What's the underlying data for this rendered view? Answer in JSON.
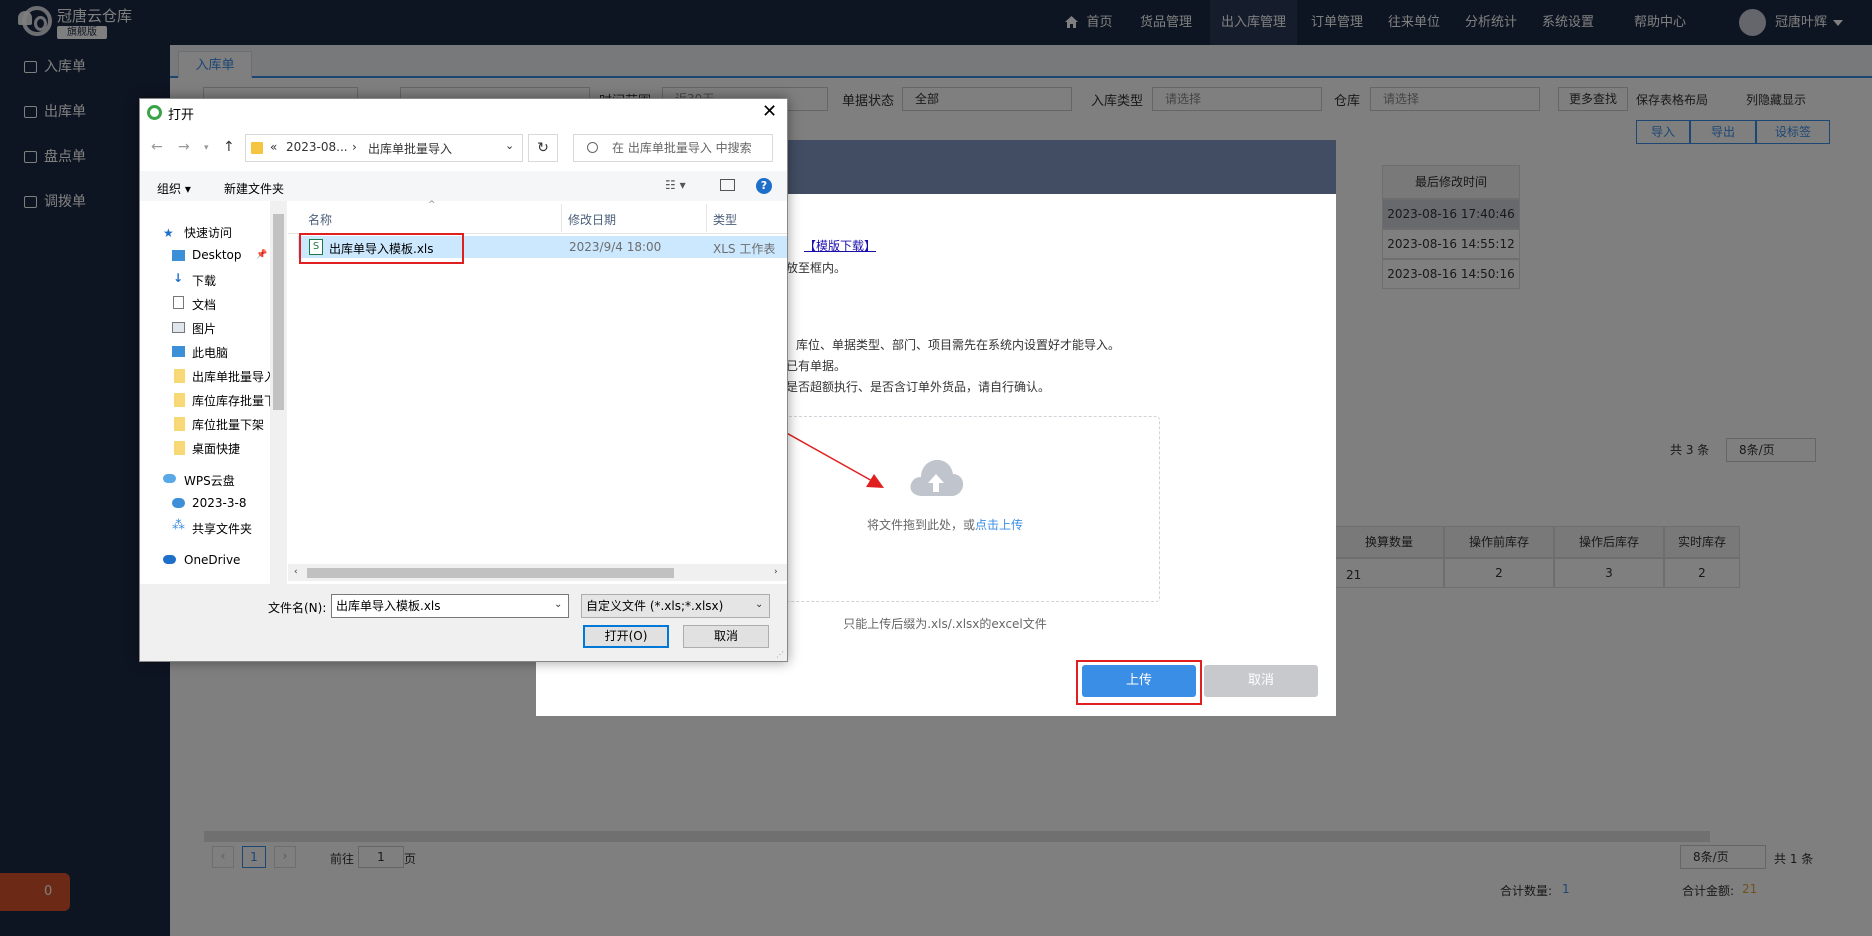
{
  "app": {
    "name": "冠唐云仓库",
    "edition": "旗舰版"
  },
  "nav": {
    "items": [
      "首页",
      "货品管理",
      "出入库管理",
      "订单管理",
      "往来单位",
      "分析统计",
      "系统设置",
      "帮助中心"
    ],
    "active": "出入库管理"
  },
  "user": {
    "name": "冠唐叶辉"
  },
  "sidebar": {
    "items": [
      "入库单",
      "出库单",
      "盘点单",
      "调拨单"
    ]
  },
  "alarm": {
    "count": "0"
  },
  "tabs": {
    "active": "入库单"
  },
  "filters": {
    "time_range_label": "时间范围",
    "time_range_value": "近30天",
    "status_label": "单据状态",
    "status_value": "全部",
    "type_label": "入库类型",
    "type_placeholder": "请选择",
    "warehouse_label": "仓库",
    "warehouse_placeholder": "请选择",
    "more_search": "更多查找",
    "save_layout": "保存表格布局",
    "hidden_cols": "列隐藏显示"
  },
  "toolbar": {
    "import": "导入",
    "export": "导出",
    "settings": "设标签"
  },
  "table1": {
    "header_last_modified": "最后修改时间",
    "last_modified": [
      "2023-08-16 17:40:46",
      "2023-08-16 14:55:12",
      "2023-08-16 14:50:16"
    ],
    "total": "共 3 条",
    "page_size": "8条/页"
  },
  "table2": {
    "headers": [
      "换算数量",
      "操作前库存",
      "操作后库存",
      "实时库存"
    ],
    "row": {
      "partial": "21",
      "before": "2",
      "after": "3",
      "realtime": "2"
    }
  },
  "pager": {
    "current": "1",
    "goto_prefix": "前往",
    "goto_value": "1",
    "goto_suffix": "页",
    "page_size": "8条/页",
    "total": "共 1 条"
  },
  "summary": {
    "qty_label": "合计数量:",
    "qty_value": "1",
    "amount_label": "合计金额:",
    "amount_value": "21"
  },
  "import_dialog": {
    "template_link": "【模版下载】",
    "line1_tail": "放至框内。",
    "line2": "库位、单据类型、部门、项目需先在系统内设置好才能导入。",
    "line3_tail": "已有单据。",
    "line4_tail": "是否超额执行、是否含订单外货品，请自行确认。",
    "drop_text": "将文件拖到此处，或",
    "drop_link": "点击上传",
    "hint": "只能上传后缀为.xls/.xlsx的excel文件",
    "upload_button": "上传",
    "cancel_button": "取消"
  },
  "file_dialog": {
    "title": "打开",
    "breadcrumb": [
      "2023-08...",
      "出库单批量导入"
    ],
    "search_placeholder": "在 出库单批量导入 中搜索",
    "organize": "组织 ▾",
    "new_folder": "新建文件夹",
    "tree": [
      "快速访问",
      "Desktop",
      "下载",
      "文档",
      "图片",
      "此电脑",
      "出库单批量导入",
      "库位库存批量下",
      "库位批量下架",
      "桌面快捷",
      "WPS云盘",
      "2023-3-8",
      "共享文件夹",
      "OneDrive"
    ],
    "columns": [
      "名称",
      "修改日期",
      "类型"
    ],
    "files": [
      {
        "name": "出库单导入模板.xls",
        "date": "2023/9/4 18:00",
        "type": "XLS 工作表"
      }
    ],
    "filename_label": "文件名(N):",
    "filename_value": "出库单导入模板.xls",
    "filetype_value": "自定义文件 (*.xls;*.xlsx)",
    "open_button": "打开(O)",
    "cancel_button": "取消"
  }
}
